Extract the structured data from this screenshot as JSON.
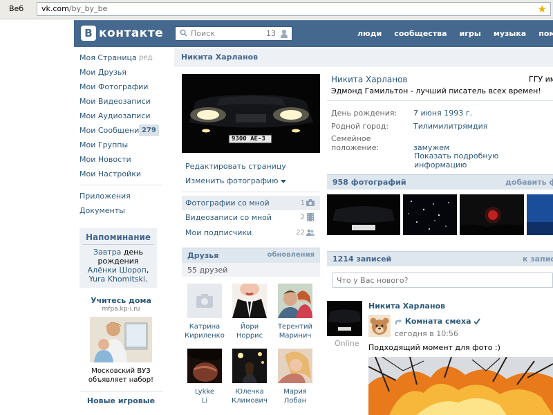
{
  "browser": {
    "tab": "Веб",
    "url_host": "vk.com",
    "url_path": "/by_by_be"
  },
  "header": {
    "logo_letter": "B",
    "logo_text": "контакте",
    "search_placeholder": "Поиск",
    "search_count": "13",
    "nav": [
      "люди",
      "сообщества",
      "игры",
      "музыка",
      "помощь"
    ]
  },
  "sidebar": {
    "items": [
      {
        "label": "Моя Страница",
        "extra": "ред."
      },
      {
        "label": "Мои Друзья"
      },
      {
        "label": "Мои Фотографии"
      },
      {
        "label": "Мои Видеозаписи"
      },
      {
        "label": "Мои Аудиозаписи"
      },
      {
        "label": "Мои Сообщения",
        "badge": "279"
      },
      {
        "label": "Мои Группы"
      },
      {
        "label": "Мои Новости"
      },
      {
        "label": "Мои Настройки"
      }
    ],
    "extra_items": [
      "Приложения",
      "Документы"
    ],
    "reminder": {
      "title": "Напоминание",
      "when": "Завтра",
      "text1": " день рождения ",
      "name1": "Алёнки Шорoп",
      "sep": ", ",
      "name2": "Yura Khomitski",
      "end": "."
    },
    "ad": {
      "title": "Учитесь дома",
      "domain": "mfpa.kp-i.ru",
      "text": "Московский ВУЗ объявляет набор!"
    },
    "ad2_title": "Новые игровые"
  },
  "profile": {
    "title": "Никита Харланов",
    "plate": "9300 AE-3",
    "edit_page": "Редактировать страницу",
    "change_photo": "Изменить фотографию",
    "rows": [
      {
        "label": "Фотографии со мной",
        "count": "1"
      },
      {
        "label": "Видеозаписи со мной",
        "count": "2"
      },
      {
        "label": "Мои подписчики",
        "count": "22"
      }
    ],
    "friends": {
      "title": "Друзья",
      "updates": "обновления",
      "count_text": "55 друзей",
      "list": [
        {
          "first": "Катрина",
          "last": "Кириленко"
        },
        {
          "first": "Йори",
          "last": "Норрис"
        },
        {
          "first": "Терентий",
          "last": "Маринич"
        },
        {
          "first": "Lykke",
          "last": "Li"
        },
        {
          "first": "Юлечка",
          "last": "Климович"
        },
        {
          "first": "Мария",
          "last": "Лобан"
        }
      ]
    }
  },
  "info": {
    "name": "Никита Харланов",
    "uni": "ГГУ им.",
    "status": "Эдмонд Гамильтон - лучший писатель всех времен!",
    "rows": [
      {
        "k": "День рождения:",
        "v": "7 июня 1993 г."
      },
      {
        "k": "Родной город:",
        "v": "Тилимилитрямдия"
      },
      {
        "k": "Семейное положение:",
        "v": "замужем"
      }
    ],
    "more": "Показать подробную информацию"
  },
  "photos": {
    "title": "958 фотографий",
    "add": "добавить фото"
  },
  "wall": {
    "title": "1214 записей",
    "to_posts": "к записям",
    "input_placeholder": "Что у Вас нового?",
    "post": {
      "author": "Никита Харланов",
      "online": "Online",
      "repost_name": "Комната смеха",
      "repost_time": "сегодня в 10:56",
      "text": "Подходящий момент для фото :)"
    }
  },
  "colors": {
    "header": "#45688e",
    "link": "#2b587a",
    "accent_bg": "#dee6ee"
  }
}
